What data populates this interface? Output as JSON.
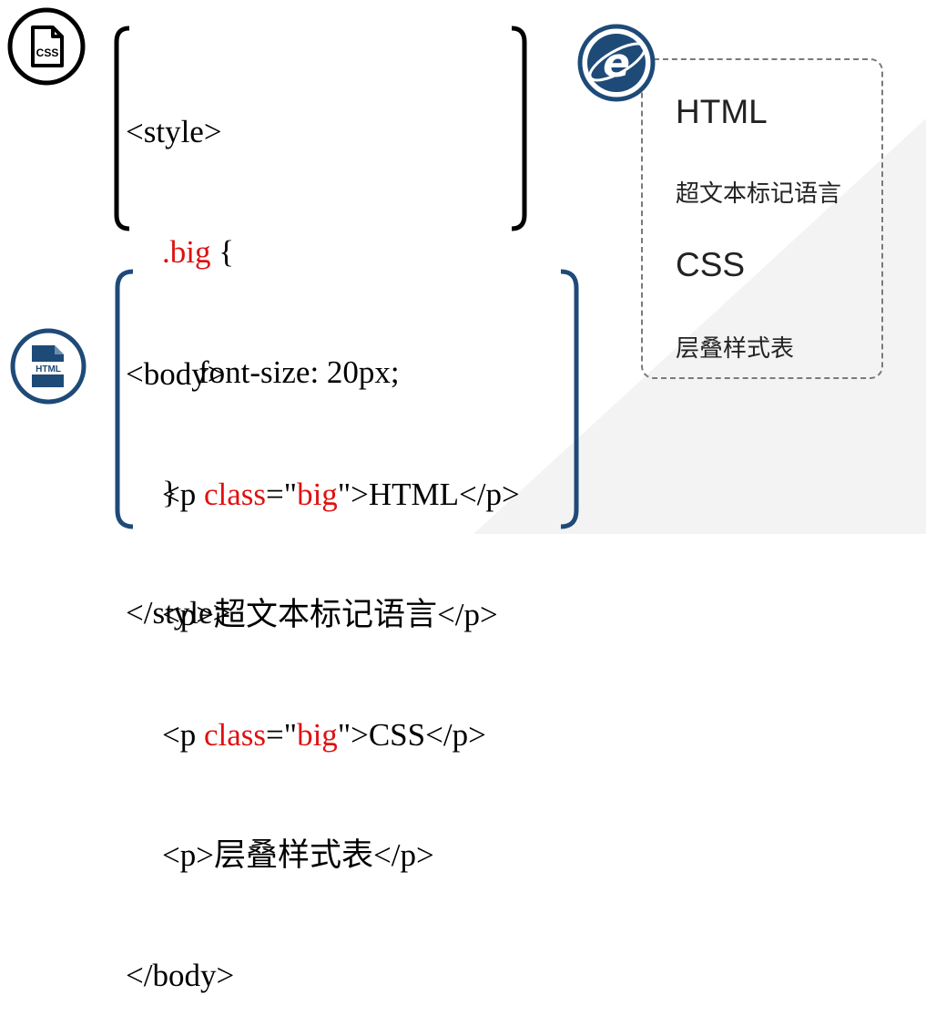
{
  "css_code": {
    "lines": [
      [
        "<style>"
      ],
      [
        ".big",
        " {"
      ],
      [
        "font-size: 20px;"
      ],
      [
        "}"
      ],
      [
        "</style>"
      ]
    ]
  },
  "html_code": {
    "open_body": "<body>",
    "p1": {
      "pre": "<p ",
      "attr": "class",
      "eq": "=\"",
      "val": "big",
      "post": "\">HTML</p>"
    },
    "p2": "<p>超文本标记语言</p>",
    "p3": {
      "pre": "<p ",
      "attr": "class",
      "eq": "=\"",
      "val": "big",
      "post": "\">CSS</p>"
    },
    "p4": "<p>层叠样式表</p>",
    "close_body": "</body>"
  },
  "icons": {
    "css_badge": "CSS",
    "html_badge": "HTML",
    "browser_letter": "e"
  },
  "preview": {
    "items": [
      "HTML",
      "超文本标记语言",
      "CSS",
      "层叠样式表"
    ]
  },
  "colors": {
    "accent_red": "#e01010",
    "navy": "#1e4a78",
    "text": "#000000"
  }
}
